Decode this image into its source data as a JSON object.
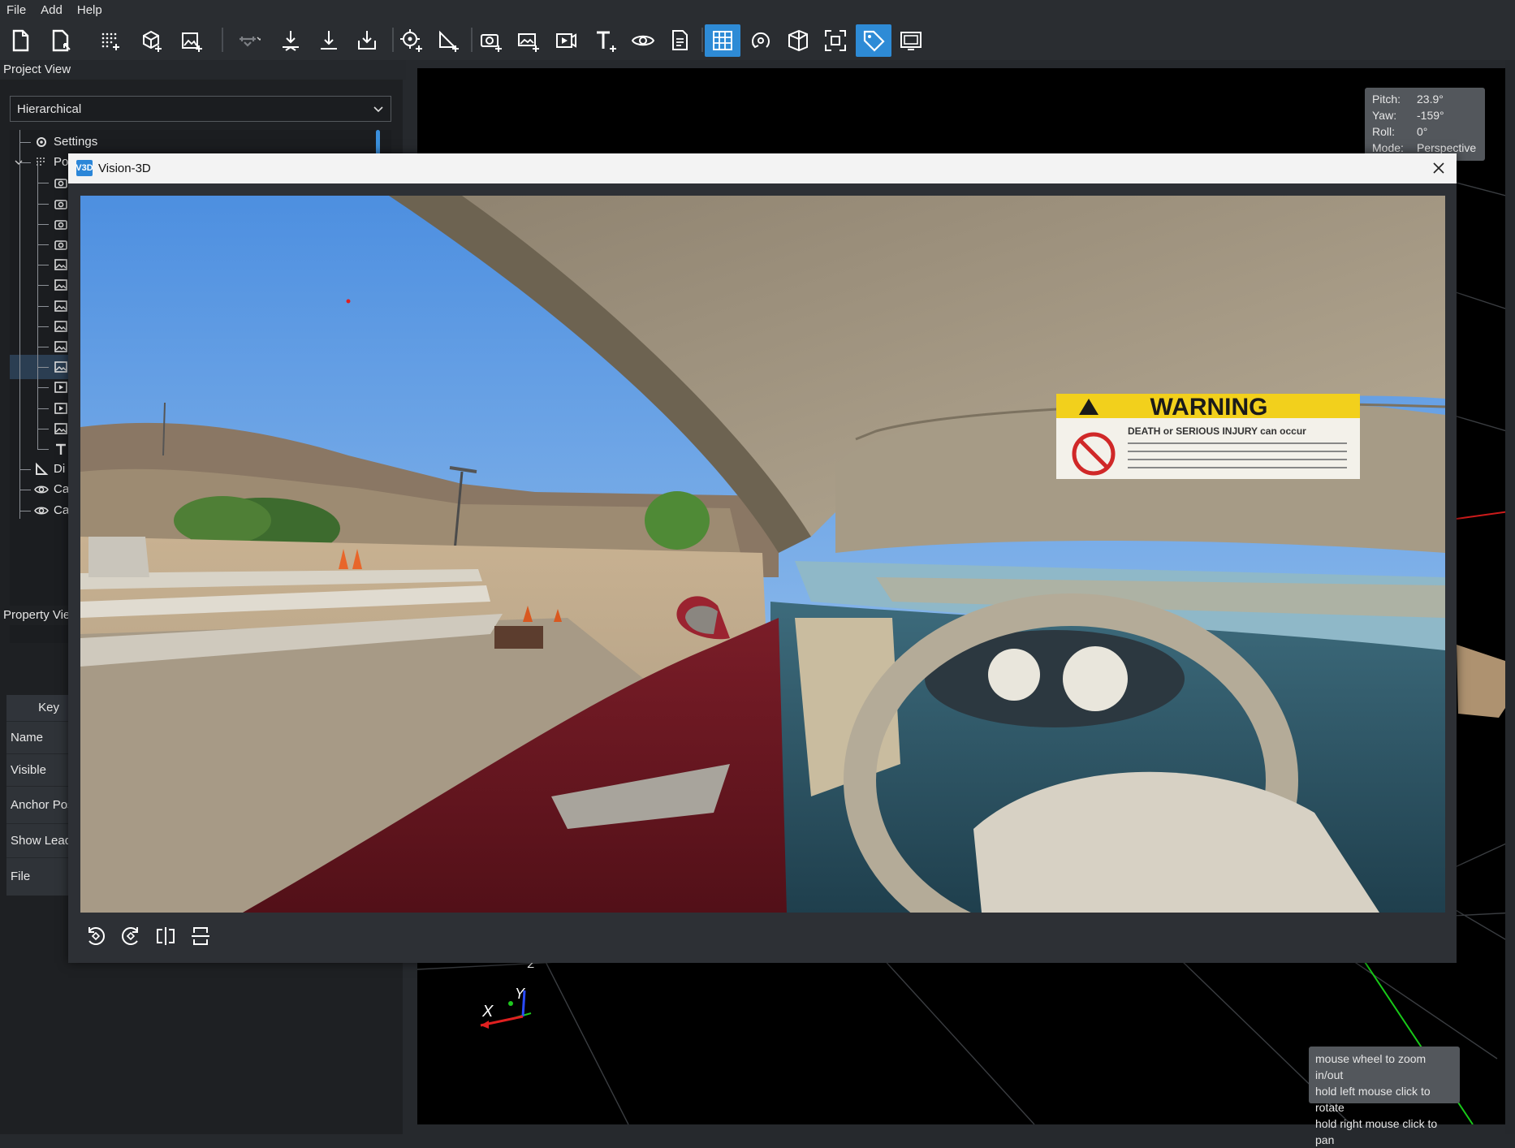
{
  "menu": [
    "File",
    "Add",
    "Help"
  ],
  "toolbar": {
    "buttons": [
      {
        "name": "new-project-icon"
      },
      {
        "name": "open-project-icon"
      },
      {
        "name": "add-point-cloud-icon"
      },
      {
        "name": "add-model-icon"
      },
      {
        "name": "add-image-icon"
      },
      {
        "name": "drone-icon"
      },
      {
        "name": "download-point-icon"
      },
      {
        "name": "download-line-icon"
      },
      {
        "name": "download-tray-icon"
      },
      {
        "name": "add-target-icon"
      },
      {
        "name": "add-measure-icon"
      },
      {
        "name": "add-camera-icon"
      },
      {
        "name": "add-panorama-icon"
      },
      {
        "name": "add-video-icon"
      },
      {
        "name": "add-text-icon"
      },
      {
        "name": "eye-icon"
      },
      {
        "name": "document-icon"
      },
      {
        "name": "grid-toggle-icon"
      },
      {
        "name": "orbit-icon"
      },
      {
        "name": "perspective-box-icon"
      },
      {
        "name": "fit-view-icon"
      },
      {
        "name": "tag-icon"
      },
      {
        "name": "screen-icon"
      }
    ]
  },
  "project_view": {
    "title": "Project View",
    "mode": "Hierarchical",
    "tree": [
      {
        "label": "Settings",
        "icon": "gear-icon"
      },
      {
        "label": "Po",
        "icon": "point-cloud-icon"
      },
      {
        "label": "",
        "icon": "camera-icon"
      },
      {
        "label": "",
        "icon": "camera-icon"
      },
      {
        "label": "",
        "icon": "camera-icon"
      },
      {
        "label": "",
        "icon": "camera-icon"
      },
      {
        "label": "",
        "icon": "image-icon"
      },
      {
        "label": "",
        "icon": "image-icon"
      },
      {
        "label": "",
        "icon": "image-icon"
      },
      {
        "label": "",
        "icon": "image-icon"
      },
      {
        "label": "",
        "icon": "image-icon"
      },
      {
        "label": "",
        "icon": "image-icon"
      },
      {
        "label": "",
        "icon": "video-icon"
      },
      {
        "label": "",
        "icon": "video-icon"
      },
      {
        "label": "",
        "icon": "image-icon"
      },
      {
        "label": "",
        "icon": "text-icon"
      },
      {
        "label": "Di",
        "icon": "measure-icon"
      },
      {
        "label": "Ca",
        "icon": "eye-icon"
      },
      {
        "label": "Ca",
        "icon": "eye-icon"
      }
    ]
  },
  "property_view": {
    "title": "Property Vie",
    "key_header": "Key",
    "rows": [
      "Name",
      "Visible",
      "Anchor Pos",
      "Show Lead",
      "File"
    ]
  },
  "camera_info": {
    "pitch_label": "Pitch:",
    "pitch": "23.9°",
    "yaw_label": "Yaw:",
    "yaw": "-159°",
    "roll_label": "Roll:",
    "roll": "0°",
    "mode_label": "Mode:",
    "mode": "Perspective"
  },
  "hints": [
    "mouse wheel to zoom in/out",
    "hold left mouse click to rotate",
    "hold right mouse click to pan"
  ],
  "axes": {
    "x": "X",
    "y": "Y",
    "z": "Z"
  },
  "vision3d": {
    "logo": "V3D",
    "title": "Vision-3D",
    "sign_title": "WARNING",
    "sign_subtitle": "DEATH or SERIOUS INJURY can occur",
    "tools": [
      {
        "name": "rotate-left-icon"
      },
      {
        "name": "rotate-right-icon"
      },
      {
        "name": "flip-horizontal-icon"
      },
      {
        "name": "flip-vertical-icon"
      }
    ]
  },
  "colors": {
    "accent": "#2e8bd6",
    "axis_x": "#e02020",
    "axis_y": "#1ec81e",
    "axis_z": "#2a4bff"
  }
}
